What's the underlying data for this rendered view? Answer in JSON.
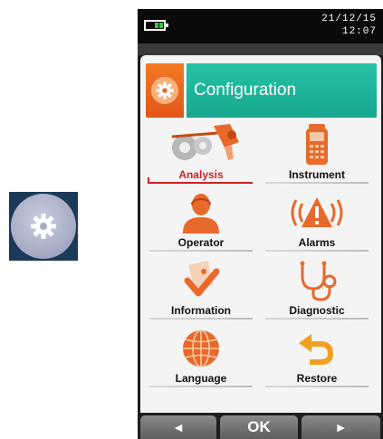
{
  "status": {
    "date": "21/12/15",
    "time": "12:07"
  },
  "header": {
    "title": "Configuration"
  },
  "menu": {
    "items": [
      {
        "label": "Analysis",
        "icon": "gears-probe-icon",
        "selected": true
      },
      {
        "label": "Instrument",
        "icon": "handheld-device-icon",
        "selected": false
      },
      {
        "label": "Operator",
        "icon": "operator-person-icon",
        "selected": false
      },
      {
        "label": "Alarms",
        "icon": "alarm-warning-icon",
        "selected": false
      },
      {
        "label": "Information",
        "icon": "information-check-icon",
        "selected": false
      },
      {
        "label": "Diagnostic",
        "icon": "stethoscope-icon",
        "selected": false
      },
      {
        "label": "Language",
        "icon": "globe-icon",
        "selected": false
      },
      {
        "label": "Restore",
        "icon": "restore-arrow-icon",
        "selected": false
      }
    ]
  },
  "softkeys": {
    "left": "◄",
    "center": "OK",
    "right": "►"
  },
  "colors": {
    "accent_orange": "#f37a22",
    "header_teal": "#1fb89c",
    "selected_red": "#d0202a"
  }
}
